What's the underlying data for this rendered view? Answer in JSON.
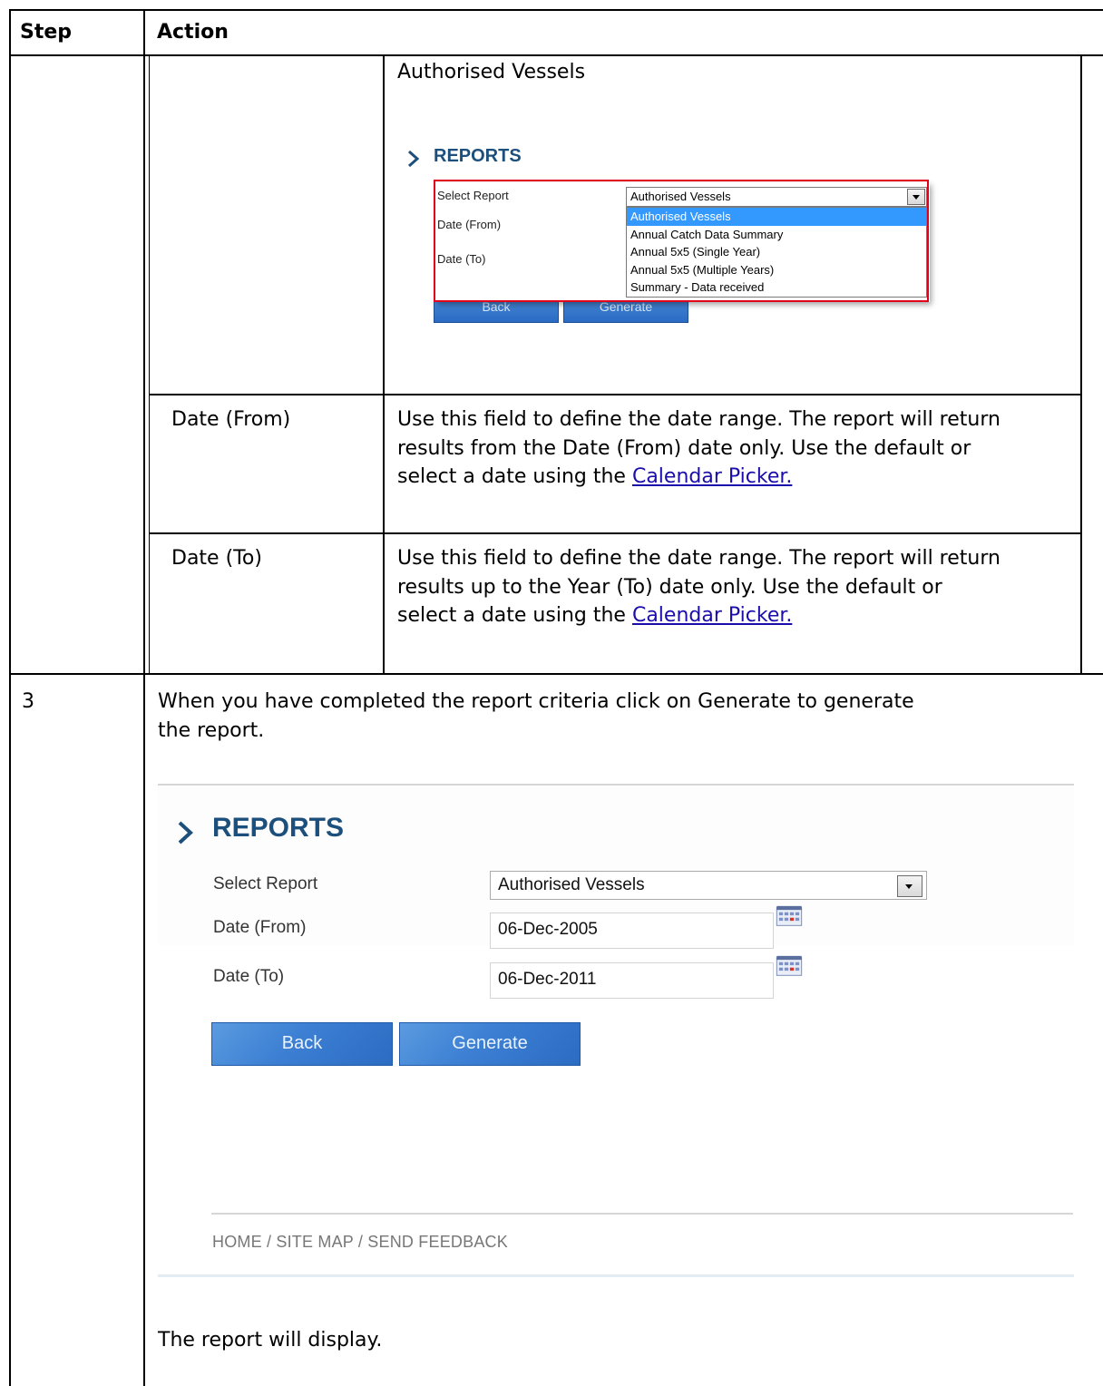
{
  "table": {
    "header": {
      "step": "Step",
      "action": "Action"
    },
    "row_select": {
      "field_title": "Authorised Vessels",
      "screenshot": {
        "heading": "REPORTS",
        "select_label": "Select Report",
        "date_from_label": "Date (From)",
        "date_to_label": "Date (To)",
        "selected": "Authorised Vessels",
        "options": [
          "Authorised Vessels",
          "Annual Catch Data Summary",
          "Annual 5x5 (Single Year)",
          "Annual 5x5 (Multiple Years)",
          "Summary - Data received"
        ],
        "back_label": "Back",
        "generate_label": "Generate"
      }
    },
    "row_date_from": {
      "field": "Date (From)",
      "desc_line1": "Use this field to define the date range. The report will return",
      "desc_line2": "results from the Date (From) date only. Use the default or",
      "desc_line3_prefix": "select a date using the ",
      "link": "Calendar Picker."
    },
    "row_date_to": {
      "field": "Date (To)",
      "desc_line1": "Use this field to define the date range. The report will return",
      "desc_line2": "results up to the Year (To) date only. Use the default or",
      "desc_line3_prefix": "select a date using the ",
      "link": "Calendar Picker."
    },
    "step3": {
      "step_number": "3",
      "instruction_line1": "When you have completed the report criteria click on Generate to generate",
      "instruction_line2": "the report.",
      "screenshot": {
        "heading": "REPORTS",
        "select_label": "Select Report",
        "select_value": "Authorised Vessels",
        "date_from_label": "Date (From)",
        "date_from_value": "06-Dec-2005",
        "date_to_label": "Date (To)",
        "date_to_value": "06-Dec-2011",
        "back_label": "Back",
        "generate_label": "Generate",
        "footer": "HOME / SITE MAP  / SEND FEEDBACK"
      },
      "result": "The report will display."
    }
  },
  "colors": {
    "heading_blue": "#1d4f7c",
    "button_blue": "#3c7fd3",
    "highlight_red": "#e0001b",
    "selection_blue": "#3399ff",
    "link": "#1a0dab"
  },
  "icons": [
    "chevron-right-icon",
    "dropdown-arrow-icon",
    "calendar-icon"
  ]
}
